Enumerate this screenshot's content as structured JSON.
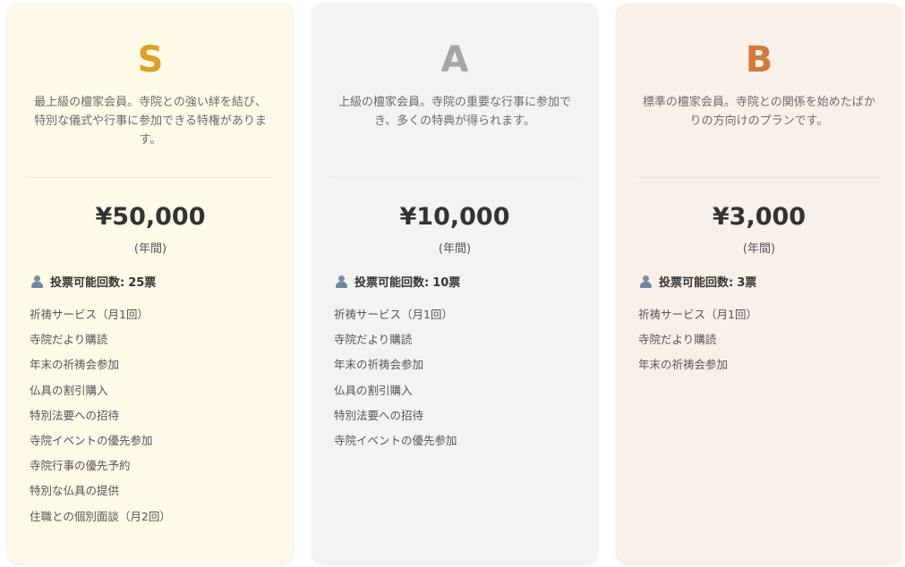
{
  "plans": [
    {
      "rank": "S",
      "description": "最上級の檀家会員。寺院との強い絆を結び、特別な儀式や行事に参加できる特権があります。",
      "price": "¥50,000",
      "period": "(年間)",
      "votes_label": "投票可能回数:",
      "votes_value": "25票",
      "features": [
        "祈祷サービス（月1回）",
        "寺院だより購読",
        "年末の祈祷会参加",
        "仏具の割引購入",
        "特別法要への招待",
        "寺院イベントの優先参加",
        "寺院行事の優先予約",
        "特別な仏具の提供",
        "住職との個別面談（月2回）"
      ],
      "color": "#d7a227"
    },
    {
      "rank": "A",
      "description": "上級の檀家会員。寺院の重要な行事に参加でき、多くの特典が得られます。",
      "price": "¥10,000",
      "period": "(年間)",
      "votes_label": "投票可能回数:",
      "votes_value": "10票",
      "features": [
        "祈祷サービス（月1回）",
        "寺院だより購読",
        "年末の祈祷会参加",
        "仏具の割引購入",
        "特別法要への招待",
        "寺院イベントの優先参加"
      ],
      "color": "#a6a6a6"
    },
    {
      "rank": "B",
      "description": "標準の檀家会員。寺院との関係を始めたばかりの方向けのプランです。",
      "price": "¥3,000",
      "period": "(年間)",
      "votes_label": "投票可能回数:",
      "votes_value": "3票",
      "features": [
        "祈祷サービス（月1回）",
        "寺院だより購読",
        "年末の祈祷会参加"
      ],
      "color": "#d17a3c"
    }
  ]
}
